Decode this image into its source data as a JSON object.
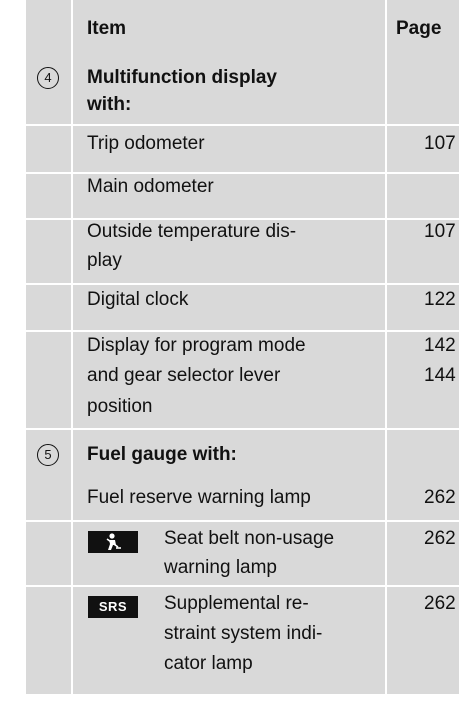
{
  "header": {
    "item": "Item",
    "page": "Page"
  },
  "section4": {
    "number": "4",
    "title_line1": "Multifunction display",
    "title_line2": "with:",
    "rows": [
      {
        "lines": [
          "Trip odometer"
        ],
        "page": "107"
      },
      {
        "lines": [
          "Main odometer"
        ],
        "page": ""
      },
      {
        "lines": [
          "Outside temperature dis-",
          "play"
        ],
        "page": "107"
      },
      {
        "lines": [
          "Digital clock"
        ],
        "page": "122"
      },
      {
        "lines": [
          "Display for program mode",
          "and gear selector lever",
          "position"
        ],
        "pages": [
          "142",
          "144"
        ]
      }
    ]
  },
  "section5": {
    "number": "5",
    "title": "Fuel gauge with:",
    "rows": [
      {
        "lines": [
          "Fuel reserve warning lamp"
        ],
        "page": "262"
      },
      {
        "icon": "seat-belt-icon",
        "lines": [
          "Seat belt non-usage",
          "warning lamp"
        ],
        "page": "262"
      },
      {
        "icon_label": "SRS",
        "lines": [
          "Supplemental re-",
          "straint system indi-",
          "cator lamp"
        ],
        "page": "262"
      }
    ]
  }
}
